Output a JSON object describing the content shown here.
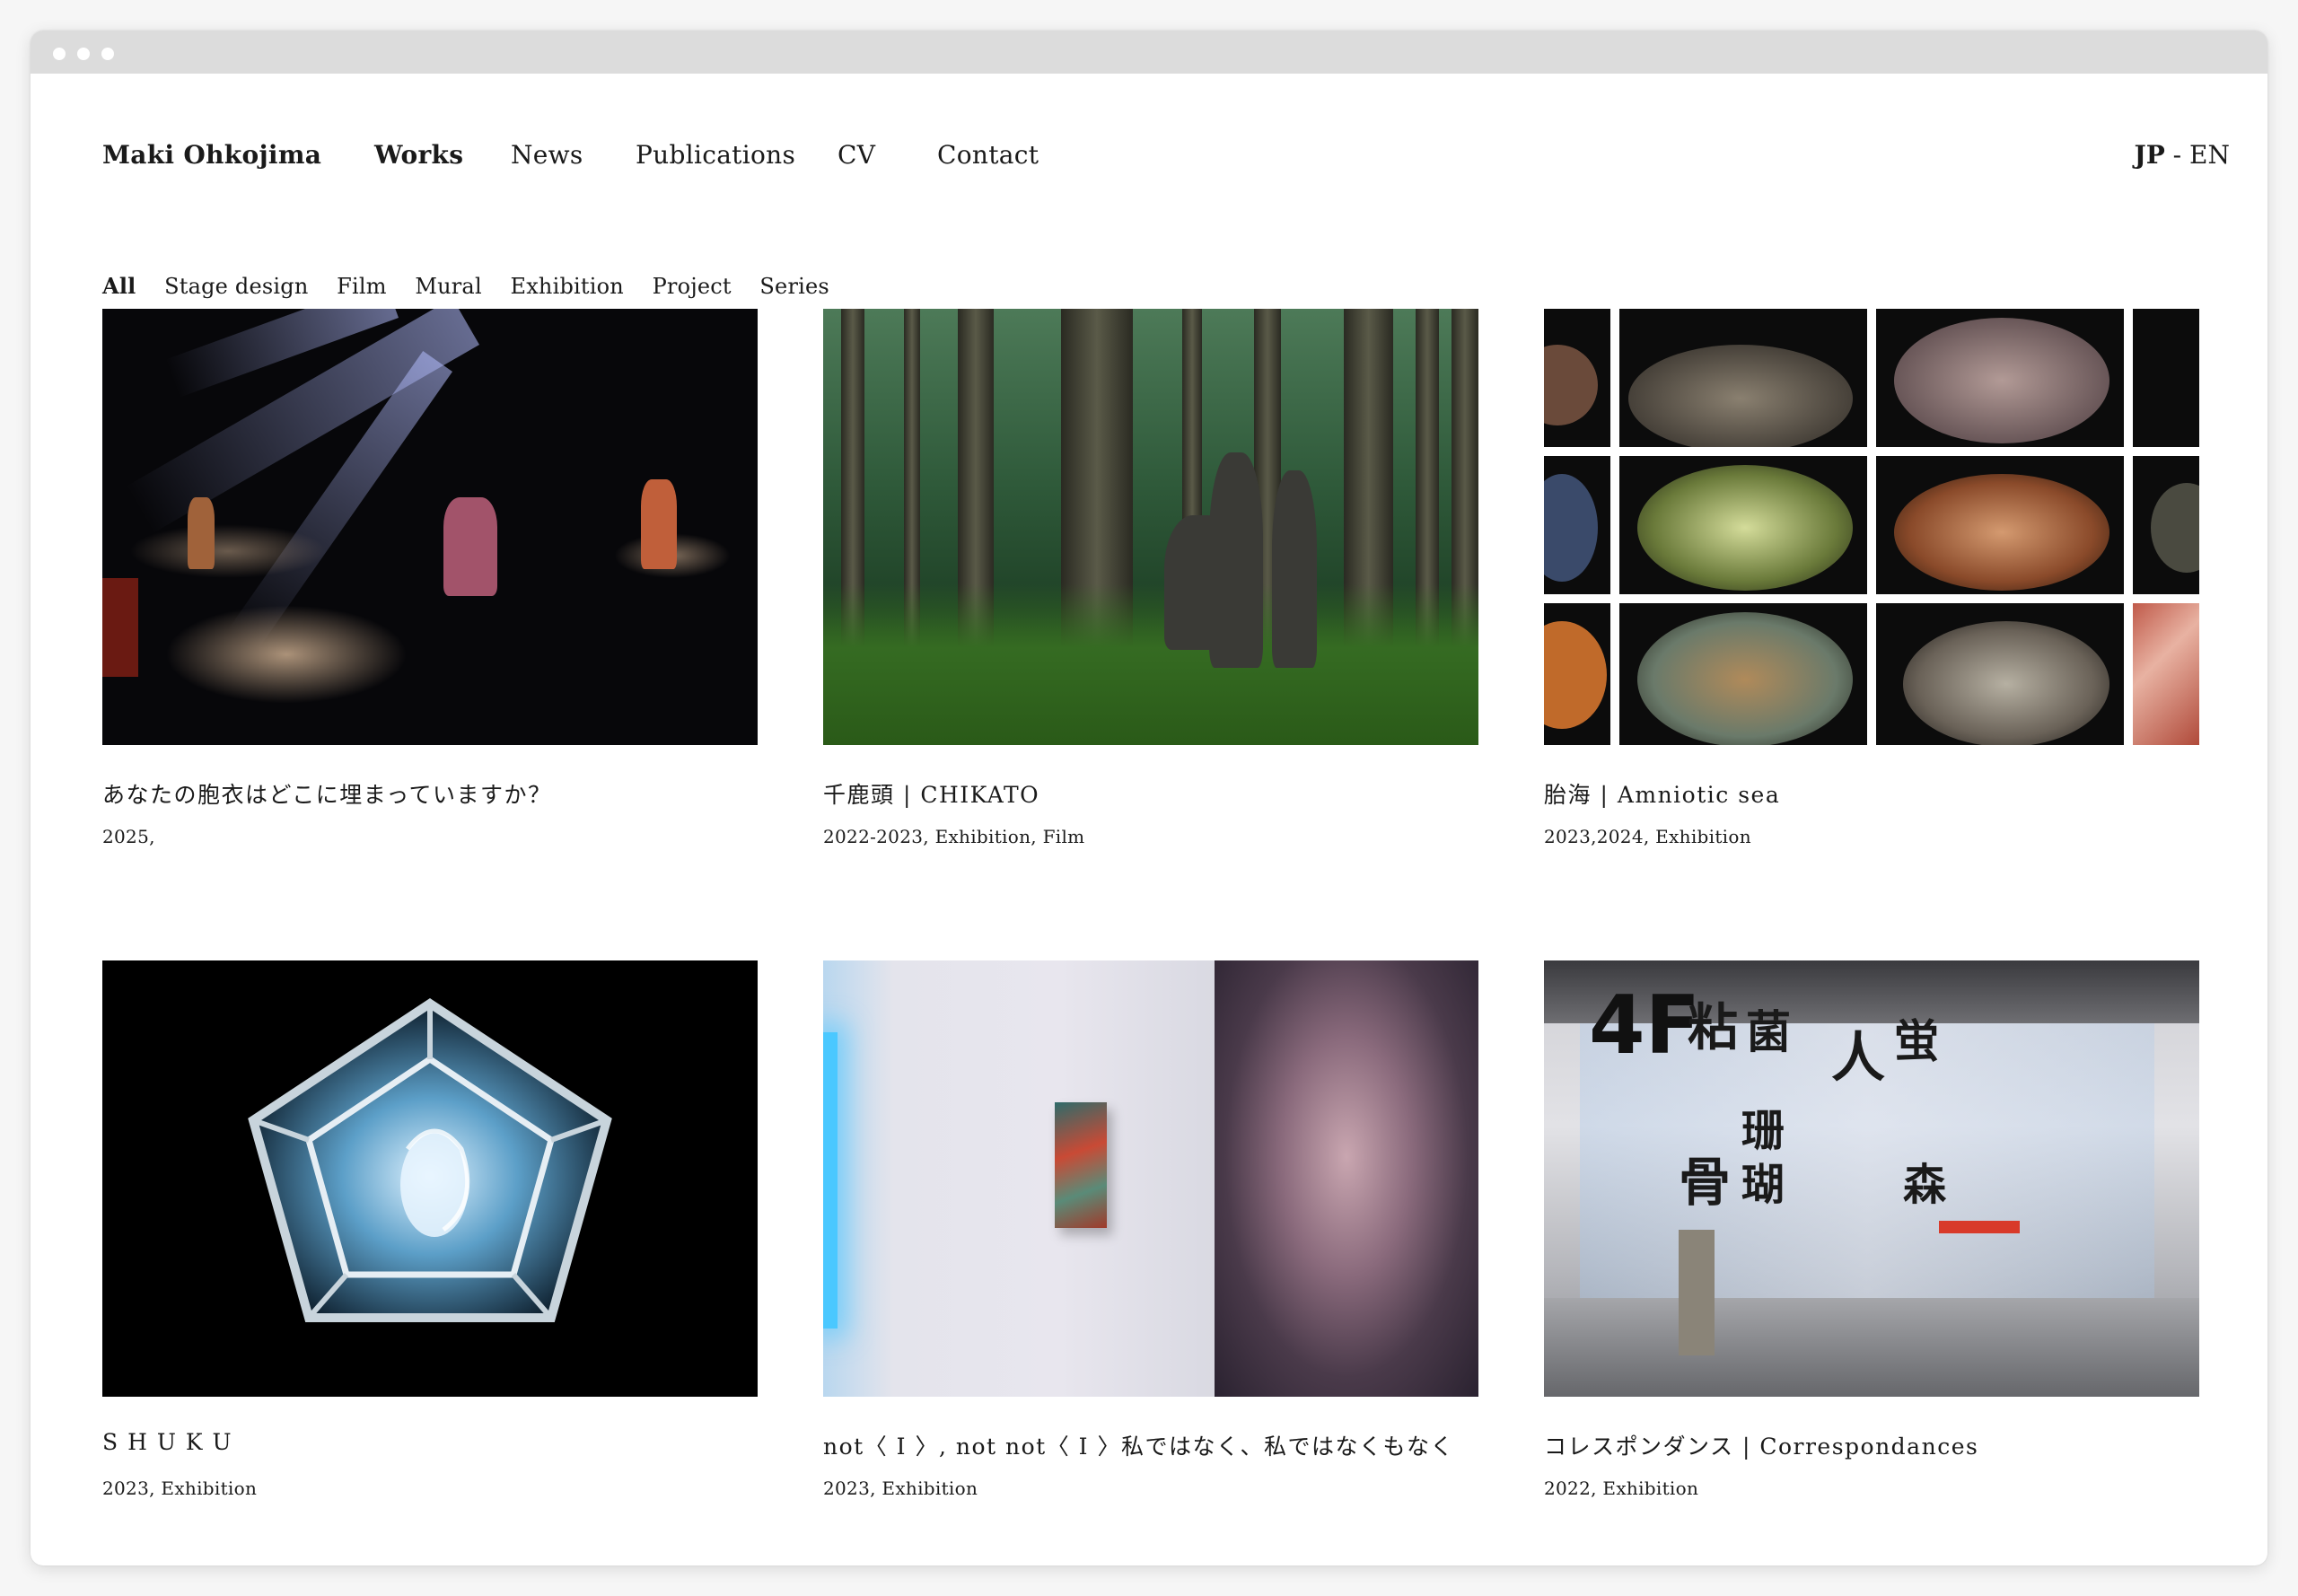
{
  "nav": {
    "brand": "Maki Ohkojima",
    "items": [
      "Works",
      "News",
      "Publications",
      "CV",
      "Contact"
    ],
    "active": "Works",
    "lang_jp": "JP",
    "lang_sep": " - ",
    "lang_en": "EN"
  },
  "filters": [
    "All",
    "Stage design",
    "Film",
    "Mural",
    "Exhibition",
    "Project",
    "Series"
  ],
  "works": [
    {
      "title": "あなたの胞衣はどこに埋まっていますか？",
      "meta": "2025,"
    },
    {
      "title": "千鹿頭 | CHIKATO",
      "meta": "2022-2023, Exhibition, Film"
    },
    {
      "title": "胎海 | Amniotic sea",
      "meta": "2023,2024, Exhibition"
    },
    {
      "title": "S H U K U",
      "meta": "2023, Exhibition"
    },
    {
      "title": "not〈 I 〉, not not〈 I 〉私ではなく、私ではなくもなく",
      "meta": "2023, Exhibition"
    },
    {
      "title": "コレスポンダンス | Correspondances",
      "meta": "2022, Exhibition"
    }
  ],
  "museum_signage": {
    "floor": "4F",
    "kanji": [
      "粘",
      "菌",
      "人",
      "蛍",
      "珊",
      "瑚",
      "骨",
      "森"
    ]
  }
}
